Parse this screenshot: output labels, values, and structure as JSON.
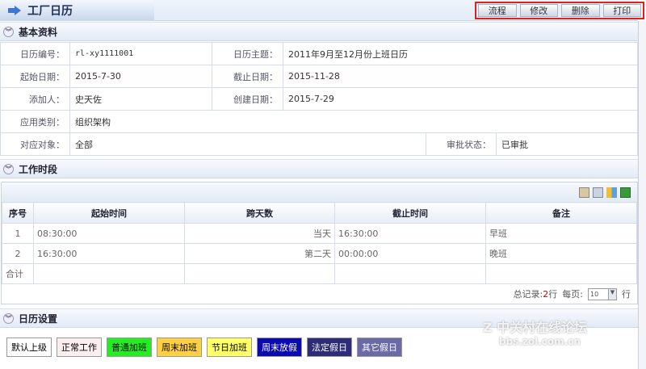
{
  "header": {
    "title": "工厂日历",
    "buttons": [
      "流程",
      "修改",
      "删除",
      "打印"
    ]
  },
  "basic": {
    "section": "基本资料",
    "code_label": "日历编号：",
    "code": "rl-xy1111001",
    "subject_label": "日历主题：",
    "subject": "2011年9月至12月份上班日历",
    "start_label": "起始日期：",
    "start": "2015-7-30",
    "end_label": "截止日期：",
    "end": "2015-11-28",
    "adder_label": "添加人：",
    "adder": "史天佐",
    "created_label": "创建日期：",
    "created": "2015-7-29",
    "category_label": "应用类别：",
    "category": "组织架构",
    "target_label": "对应对象：",
    "target": "全部",
    "status_label": "审批状态：",
    "status": "已审批"
  },
  "periods": {
    "section": "工作时段",
    "columns": [
      "序号",
      "起始时间",
      "跨天数",
      "截止时间",
      "备注"
    ],
    "rows": [
      [
        "1",
        "08:30:00",
        "当天",
        "16:30:00",
        "早班"
      ],
      [
        "2",
        "16:30:00",
        "第二天",
        "00:00:00",
        "晚班"
      ]
    ],
    "total_label": "合计",
    "records_label": "总记录:",
    "records": "2",
    "records_unit": "行",
    "per_page_label": "每页:",
    "per_page": "10",
    "per_page_unit": "行"
  },
  "settings": {
    "section": "日历设置",
    "types": [
      {
        "label": "默认上级",
        "bg": "#ffffff",
        "fg": "#000000"
      },
      {
        "label": "正常工作",
        "bg": "#fbeeee",
        "fg": "#000000"
      },
      {
        "label": "普通加班",
        "bg": "#22ee22",
        "fg": "#000000"
      },
      {
        "label": "周末加班",
        "bg": "#ffd040",
        "fg": "#000000"
      },
      {
        "label": "节日加班",
        "bg": "#ffff66",
        "fg": "#000000"
      },
      {
        "label": "周末放假",
        "bg": "#0a0ab0",
        "fg": "#ffffff"
      },
      {
        "label": "法定假日",
        "bg": "#2c2c78",
        "fg": "#ffffff"
      },
      {
        "label": "其它假日",
        "bg": "#6a6aa8",
        "fg": "#ffffff"
      }
    ]
  },
  "watermark": {
    "line1": "中关村在线论坛",
    "line2": "bbs.zol.com.cn"
  }
}
